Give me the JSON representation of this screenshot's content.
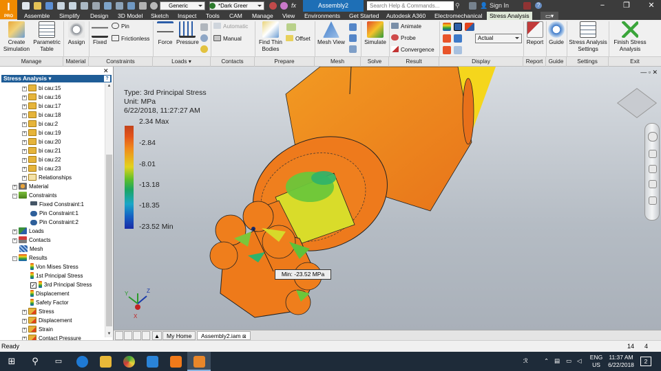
{
  "titlebar": {
    "app_badge": "I",
    "app_badge_sub": "PRO",
    "material_dropdown": "Generic",
    "appearance_dropdown": "*Dark Greer",
    "fx_label": "fx",
    "document_title": "Assembly2",
    "search_placeholder": "Search Help & Commands...",
    "sign_in": "Sign In",
    "help": "?",
    "window_controls": [
      "−",
      "❐",
      "✕"
    ]
  },
  "menu_tabs": [
    "Assemble",
    "Simplify",
    "Design",
    "3D Model",
    "Sketch",
    "Inspect",
    "Tools",
    "CAM",
    "Manage",
    "View",
    "Environments",
    "Get Started",
    "Autodesk A360",
    "Electromechanical",
    "Stress Analysis"
  ],
  "active_tab": "Stress Analysis",
  "ribbon": {
    "create_simulation": "Create Simulation",
    "parametric_table": "Parametric Table",
    "assign": "Assign",
    "fixed": "Fixed",
    "pin": "Pin",
    "frictionless": "Frictionless",
    "force": "Force",
    "pressure": "Pressure",
    "automatic": "Automatic",
    "manual": "Manual",
    "find_thin_bodies": "Find Thin Bodies",
    "offset": "Offset",
    "mesh_view": "Mesh View",
    "simulate": "Simulate",
    "animate": "Animate",
    "probe": "Probe",
    "convergence": "Convergence",
    "display_scale": "Actual",
    "report": "Report",
    "guide": "Guide",
    "stress_analysis_settings": "Stress Analysis Settings",
    "finish_stress_analysis": "Finish Stress Analysis",
    "groups": [
      "Manage",
      "Material",
      "Constraints",
      "Loads ▾",
      "Contacts",
      "Prepare",
      "Mesh",
      "Solve",
      "Result",
      "Display",
      "Report",
      "Guide",
      "Settings",
      "Exit"
    ]
  },
  "browser": {
    "header": "Stress Analysis ▾",
    "help": "?",
    "parts": [
      "bi cau:15",
      "bi cau:16",
      "bi cau:17",
      "bi cau:18",
      "bi cau:2",
      "bi cau:19",
      "bi cau:20",
      "bi cau:21",
      "bi cau:22",
      "bi cau:23"
    ],
    "relationships": "Relationships",
    "material": "Material",
    "constraints": "Constraints",
    "constraint_items": [
      "Fixed Constraint:1",
      "Pin Constraint:1",
      "Pin Constraint:2"
    ],
    "loads": "Loads",
    "contacts": "Contacts",
    "mesh": "Mesh",
    "results": "Results",
    "result_items": [
      "Von Mises Stress",
      "1st Principal Stress",
      "3rd Principal Stress",
      "Displacement",
      "Safety Factor"
    ],
    "checked_result": "3rd Principal Stress",
    "result_folders": [
      "Stress",
      "Displacement",
      "Strain",
      "Contact Pressure"
    ]
  },
  "legend": {
    "type_line": "Type: 3rd Principal Stress",
    "unit_line": "Unit: MPa",
    "date_line": "6/22/2018, 11:27:27 AM",
    "scale_labels": [
      "2.34 Max",
      "-2.84",
      "-8.01",
      "-13.18",
      "-18.35",
      "-23.52 Min"
    ],
    "colors": [
      "#c2431b",
      "#f08a1c",
      "#e2d31e",
      "#5dbf2b",
      "#19a6c8",
      "#1a2ba6"
    ]
  },
  "viewport": {
    "min_probe_label": "Min: -23.52 MPa",
    "triad_labels": [
      "X",
      "Y",
      "Z"
    ],
    "view_minimize": "— ▫ ✕"
  },
  "doc_tabs": [
    "My Home",
    "Assembly2.iam"
  ],
  "statusbar": {
    "status": "Ready",
    "count_a": "14",
    "count_b": "4"
  },
  "taskbar": {
    "language": "ENG",
    "region": "US",
    "time": "11:37 AM",
    "date": "6/22/2018",
    "notifications": "2"
  }
}
